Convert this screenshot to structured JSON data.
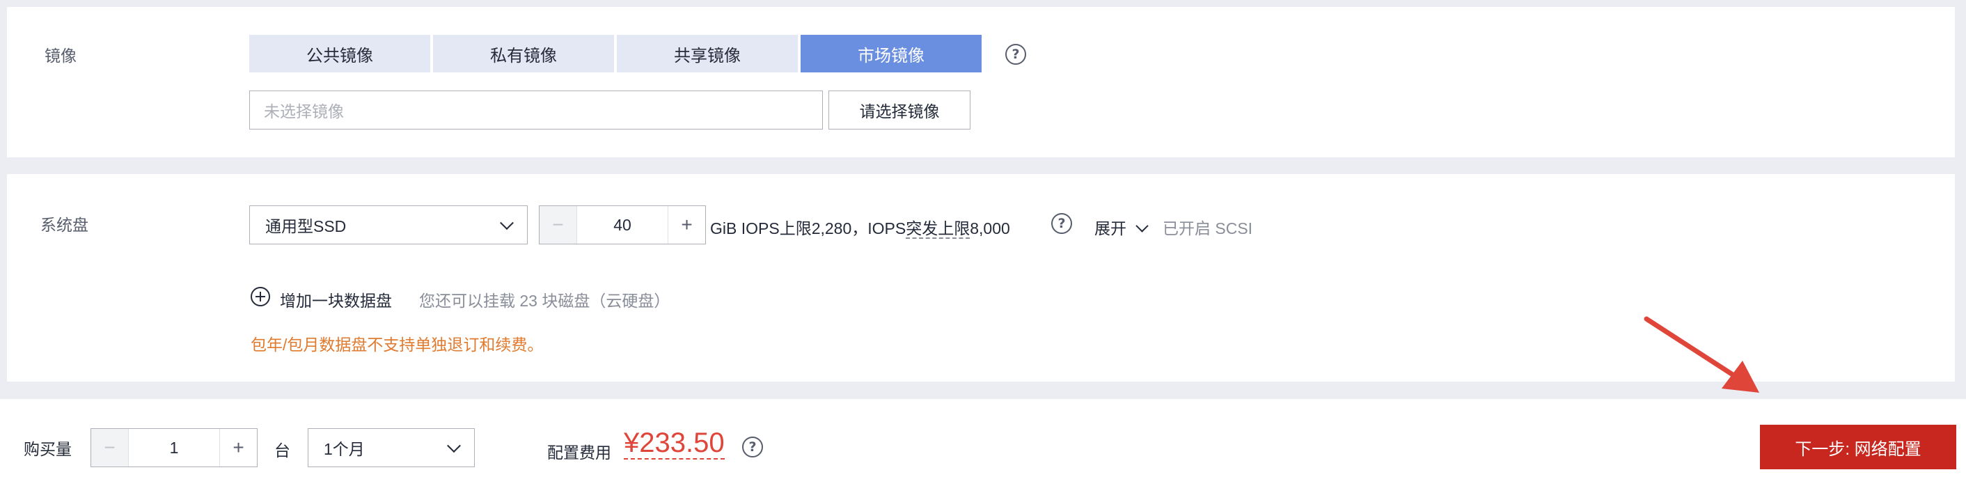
{
  "image_section": {
    "label": "镜像",
    "tabs": [
      "公共镜像",
      "私有镜像",
      "共享镜像",
      "市场镜像"
    ],
    "active_tab": "市场镜像",
    "help": "?",
    "image_input_placeholder": "未选择镜像",
    "select_button": "请选择镜像"
  },
  "disk_section": {
    "label": "系统盘",
    "disk_type": "通用型SSD",
    "size_value": "40",
    "minus": "−",
    "plus": "+",
    "info_prefix": "GiB IOPS上限2,280，IOPS",
    "info_burst": "突发上限",
    "info_suffix": "8,000",
    "help": "?",
    "expand_label": "展开",
    "scsi_status": "已开启 SCSI",
    "add_disk_label": "增加一块数据盘",
    "add_disk_hint": "您还可以挂载 23 块磁盘（云硬盘）",
    "warning": "包年/包月数据盘不支持单独退订和续费。"
  },
  "footer": {
    "quantity_label": "购买量",
    "quantity_value": "1",
    "minus": "−",
    "plus": "+",
    "unit": "台",
    "duration": "1个月",
    "fee_label": "配置费用",
    "price": "¥233.50",
    "help": "?",
    "next_button": "下一步: 网络配置"
  },
  "colors": {
    "active_tab": "#6a8fe0",
    "primary_button": "#c7271e",
    "price": "#e0453a",
    "warning": "#e07a2e",
    "annotation_arrow": "#e0453a"
  }
}
